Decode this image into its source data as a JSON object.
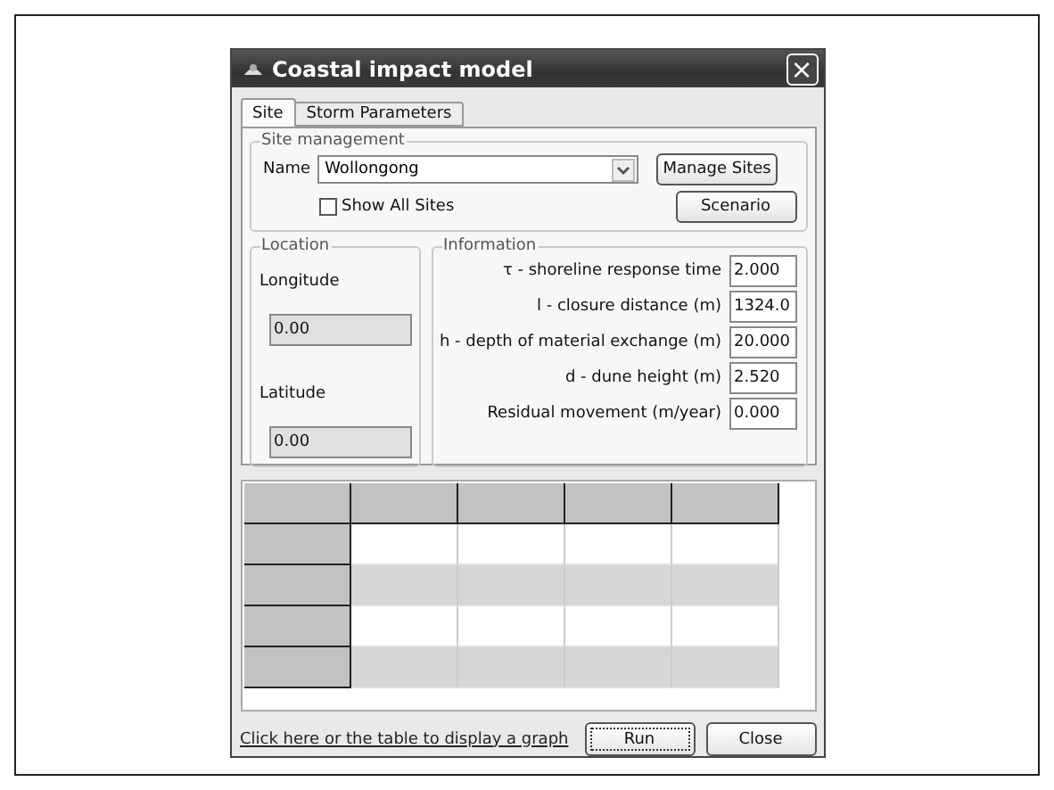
{
  "window": {
    "title": "Coastal impact model",
    "close": "×"
  },
  "tabs": [
    {
      "label": "Site",
      "selected": true
    },
    {
      "label": "Storm Parameters",
      "selected": false
    }
  ],
  "site_management": {
    "legend": "Site management",
    "name_label": "Name",
    "name_value": "Wollongong",
    "show_all": {
      "label": "Show All Sites",
      "checked": false
    },
    "buttons": [
      "Manage Sites",
      "Scenario"
    ]
  },
  "location": {
    "legend": "Location",
    "fields": [
      {
        "label": "Longitude",
        "value": "0.00"
      },
      {
        "label": "Latitude",
        "value": "0.00"
      }
    ]
  },
  "information": {
    "legend": "Information",
    "fields": [
      {
        "label": "τ - shoreline response time",
        "value": "2.000"
      },
      {
        "label": "l - closure distance (m)",
        "value": "1324.0"
      },
      {
        "label": "h - depth of material exchange (m)",
        "value": "20.000"
      },
      {
        "label": "d - dune height (m)",
        "value": "2.520"
      },
      {
        "label": "Residual movement (m/year)",
        "value": "0.000"
      }
    ]
  },
  "table": {
    "rows": [
      {
        "shaded": false
      },
      {
        "shaded": true
      },
      {
        "shaded": false
      },
      {
        "shaded": true
      }
    ]
  },
  "graph_link": "Click here or the table to display a graph",
  "buttons": [
    {
      "label": "Run",
      "focused": true
    },
    {
      "label": "Close",
      "focused": false
    }
  ]
}
